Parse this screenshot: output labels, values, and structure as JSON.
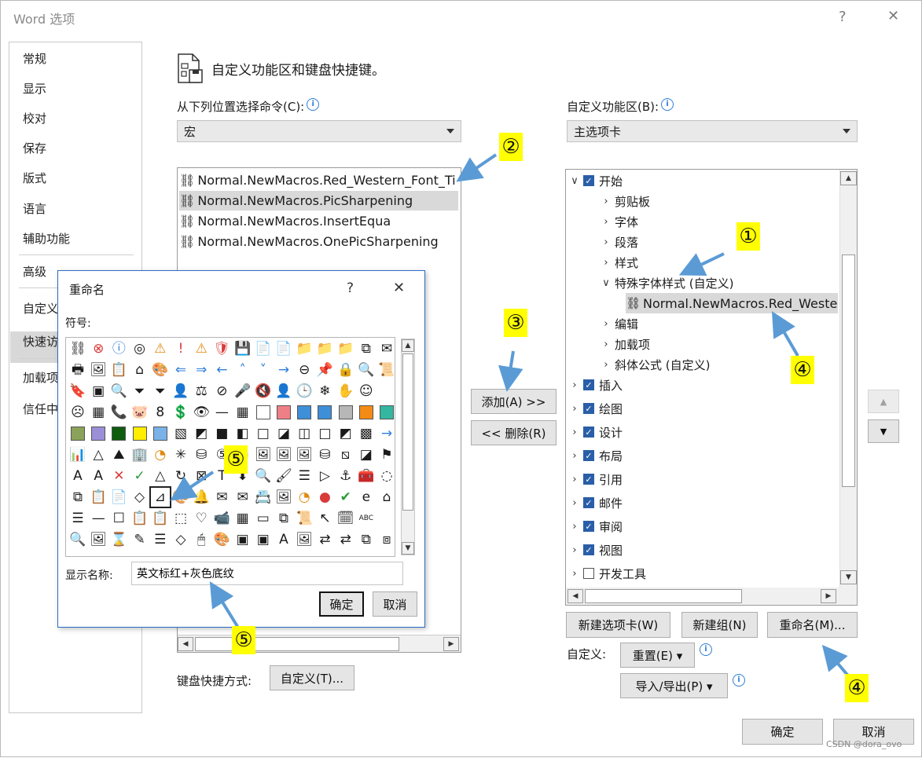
{
  "window": {
    "title": "Word 选项",
    "help": "?",
    "close": "✕"
  },
  "nav": {
    "items": [
      "常规",
      "显示",
      "校对",
      "保存",
      "版式",
      "语言",
      "辅助功能",
      "高级",
      "自定义",
      "快速访",
      "加载项",
      "信任中"
    ],
    "selected": "自定义"
  },
  "header": {
    "title": "自定义功能区和键盘快捷键。"
  },
  "left": {
    "label": "从下列位置选择命令(C):",
    "combo_value": "宏",
    "macros": [
      "Normal.NewMacros.Red_Western_Font_Ti",
      "Normal.NewMacros.PicSharpening",
      "Normal.NewMacros.InsertEqua",
      "Normal.NewMacros.OnePicSharpening"
    ],
    "selected_macro": "Normal.NewMacros.PicSharpening"
  },
  "right": {
    "label": "自定义功能区(B):",
    "combo_value": "主选项卡",
    "tree": [
      {
        "chev": "∨",
        "checked": true,
        "label": "开始",
        "level": 0
      },
      {
        "chev": "›",
        "label": "剪贴板",
        "level": 1
      },
      {
        "chev": "›",
        "label": "字体",
        "level": 1
      },
      {
        "chev": "›",
        "label": "段落",
        "level": 1
      },
      {
        "chev": "›",
        "label": "样式",
        "level": 1
      },
      {
        "chev": "∨",
        "label": "特殊字体样式 (自定义)",
        "level": 1
      },
      {
        "label": "Normal.NewMacros.Red_Weste",
        "level": 2,
        "selected": true,
        "macro": true
      },
      {
        "chev": "›",
        "label": "编辑",
        "level": 1
      },
      {
        "chev": "›",
        "label": "加载项",
        "level": 1
      },
      {
        "chev": "›",
        "label": "斜体公式 (自定义)",
        "level": 1
      },
      {
        "chev": "›",
        "checked": true,
        "label": "插入",
        "level": 0
      },
      {
        "chev": "›",
        "checked": true,
        "label": "绘图",
        "level": 0
      },
      {
        "chev": "›",
        "checked": true,
        "label": "设计",
        "level": 0
      },
      {
        "chev": "›",
        "checked": true,
        "label": "布局",
        "level": 0
      },
      {
        "chev": "›",
        "checked": true,
        "label": "引用",
        "level": 0
      },
      {
        "chev": "›",
        "checked": true,
        "label": "邮件",
        "level": 0
      },
      {
        "chev": "›",
        "checked": true,
        "label": "审阅",
        "level": 0
      },
      {
        "chev": "›",
        "checked": true,
        "label": "视图",
        "level": 0
      },
      {
        "chev": "›",
        "checked": false,
        "label": "开发工具",
        "level": 0
      }
    ],
    "new_tab_button": "新建选项卡(W)",
    "new_group_button": "新建组(N)",
    "rename_button": "重命名(M)...",
    "customize_label": "自定义:",
    "reset_button": "重置(E) ▾",
    "import_export_button": "导入/导出(P) ▾"
  },
  "middle": {
    "add_button": "添加(A) >>",
    "remove_button": "<< 删除(R)"
  },
  "keyboard": {
    "label": "键盘快捷方式:",
    "button": "自定义(T)..."
  },
  "footer": {
    "ok": "确定",
    "cancel": "取消",
    "watermark": "CSDN @dora_ovo"
  },
  "rename_dialog": {
    "title": "重命名",
    "help": "?",
    "close": "✕",
    "symbols_label": "符号:",
    "display_name_label": "显示名称:",
    "display_name_value": "英文标红+灰色底纹",
    "ok": "确定",
    "cancel": "取消",
    "symbols": [
      [
        "⛓",
        "⊗",
        "ⓘ",
        "◎",
        "⚠",
        "!",
        "⚠",
        "🛡",
        "💾",
        "📄",
        "📄",
        "📁",
        "📁",
        "📁",
        "⧉",
        "✉"
      ],
      [
        "🖶",
        "🖼",
        "📋",
        "⌂",
        "🎨",
        "⇐",
        "⇒",
        "←",
        "˄",
        "˅",
        "→",
        "⊖",
        "📌",
        "🔒",
        "🔍",
        "📜"
      ],
      [
        "🔖",
        "▣",
        "🔍",
        "⏷",
        "⏷",
        "👤",
        "⚖",
        "⊘",
        "🎤",
        "🔇",
        "👤",
        "🕒",
        "❄",
        "✋",
        "☺",
        ""
      ],
      [
        "☹",
        "▦",
        "📞",
        "🐷",
        "8",
        "💲",
        "👁",
        "—",
        "▦",
        "□",
        "■",
        "■",
        "■",
        "■",
        "■",
        "■"
      ],
      [
        "■",
        "■",
        "■",
        "■",
        "■",
        "▧",
        "◩",
        "■",
        "◧",
        "□",
        "◪",
        "◫",
        "□",
        "◩",
        "▩",
        "→"
      ],
      [
        "📊",
        "△",
        "⛰",
        "🏢",
        "◔",
        "✳",
        "⛁",
        "⑤",
        "▭",
        "🖼",
        "🖼",
        "🖼",
        "⛁",
        "⧅",
        "◪",
        "⚑"
      ],
      [
        "A",
        "A",
        "✕",
        "✓",
        "△",
        "↻",
        "⊠",
        "T",
        "⬇",
        "🔍",
        "🖌",
        "☰",
        "▷",
        "⚓",
        "🧰",
        "◌"
      ],
      [
        "⧉",
        "📋",
        "📄",
        "◇",
        "⊿",
        "🎨",
        "🔔",
        "✉",
        "✉",
        "📇",
        "🖼",
        "◔",
        "●",
        "✔",
        "e",
        "⌂"
      ],
      [
        "☰",
        "—",
        "☐",
        "📋",
        "📋",
        "⬚",
        "♡",
        "📹",
        "▦",
        "▭",
        "⧉",
        "📜",
        "↖",
        "🗓",
        "ABC",
        ""
      ],
      [
        "🔍",
        "🖼",
        "⌛",
        "✎",
        "☰",
        "◇",
        "🖱",
        "🎨",
        "▣",
        "▣",
        "A",
        "🖼",
        "⇄",
        "⇄",
        "⧉",
        "⧈"
      ]
    ],
    "swatch_colors": {
      "row3": [
        "#ffffff",
        "#ef7f86",
        "#3d8fd8",
        "#3d8fd8",
        "#b7b7b7",
        "#f48b14",
        "#34b7a0"
      ],
      "row4": [
        "#8aa25a",
        "#9b8fd8",
        "#0e5c0e",
        "#ffee00",
        "#7ab2e8"
      ]
    }
  },
  "annotations": [
    "①",
    "②",
    "③",
    "④",
    "④",
    "⑤",
    "⑤"
  ],
  "colors": {
    "accent": "#2a5ea8",
    "arrow": "#5b9bd5",
    "badge": "#ffff00",
    "selection": "#d9d9d9"
  }
}
